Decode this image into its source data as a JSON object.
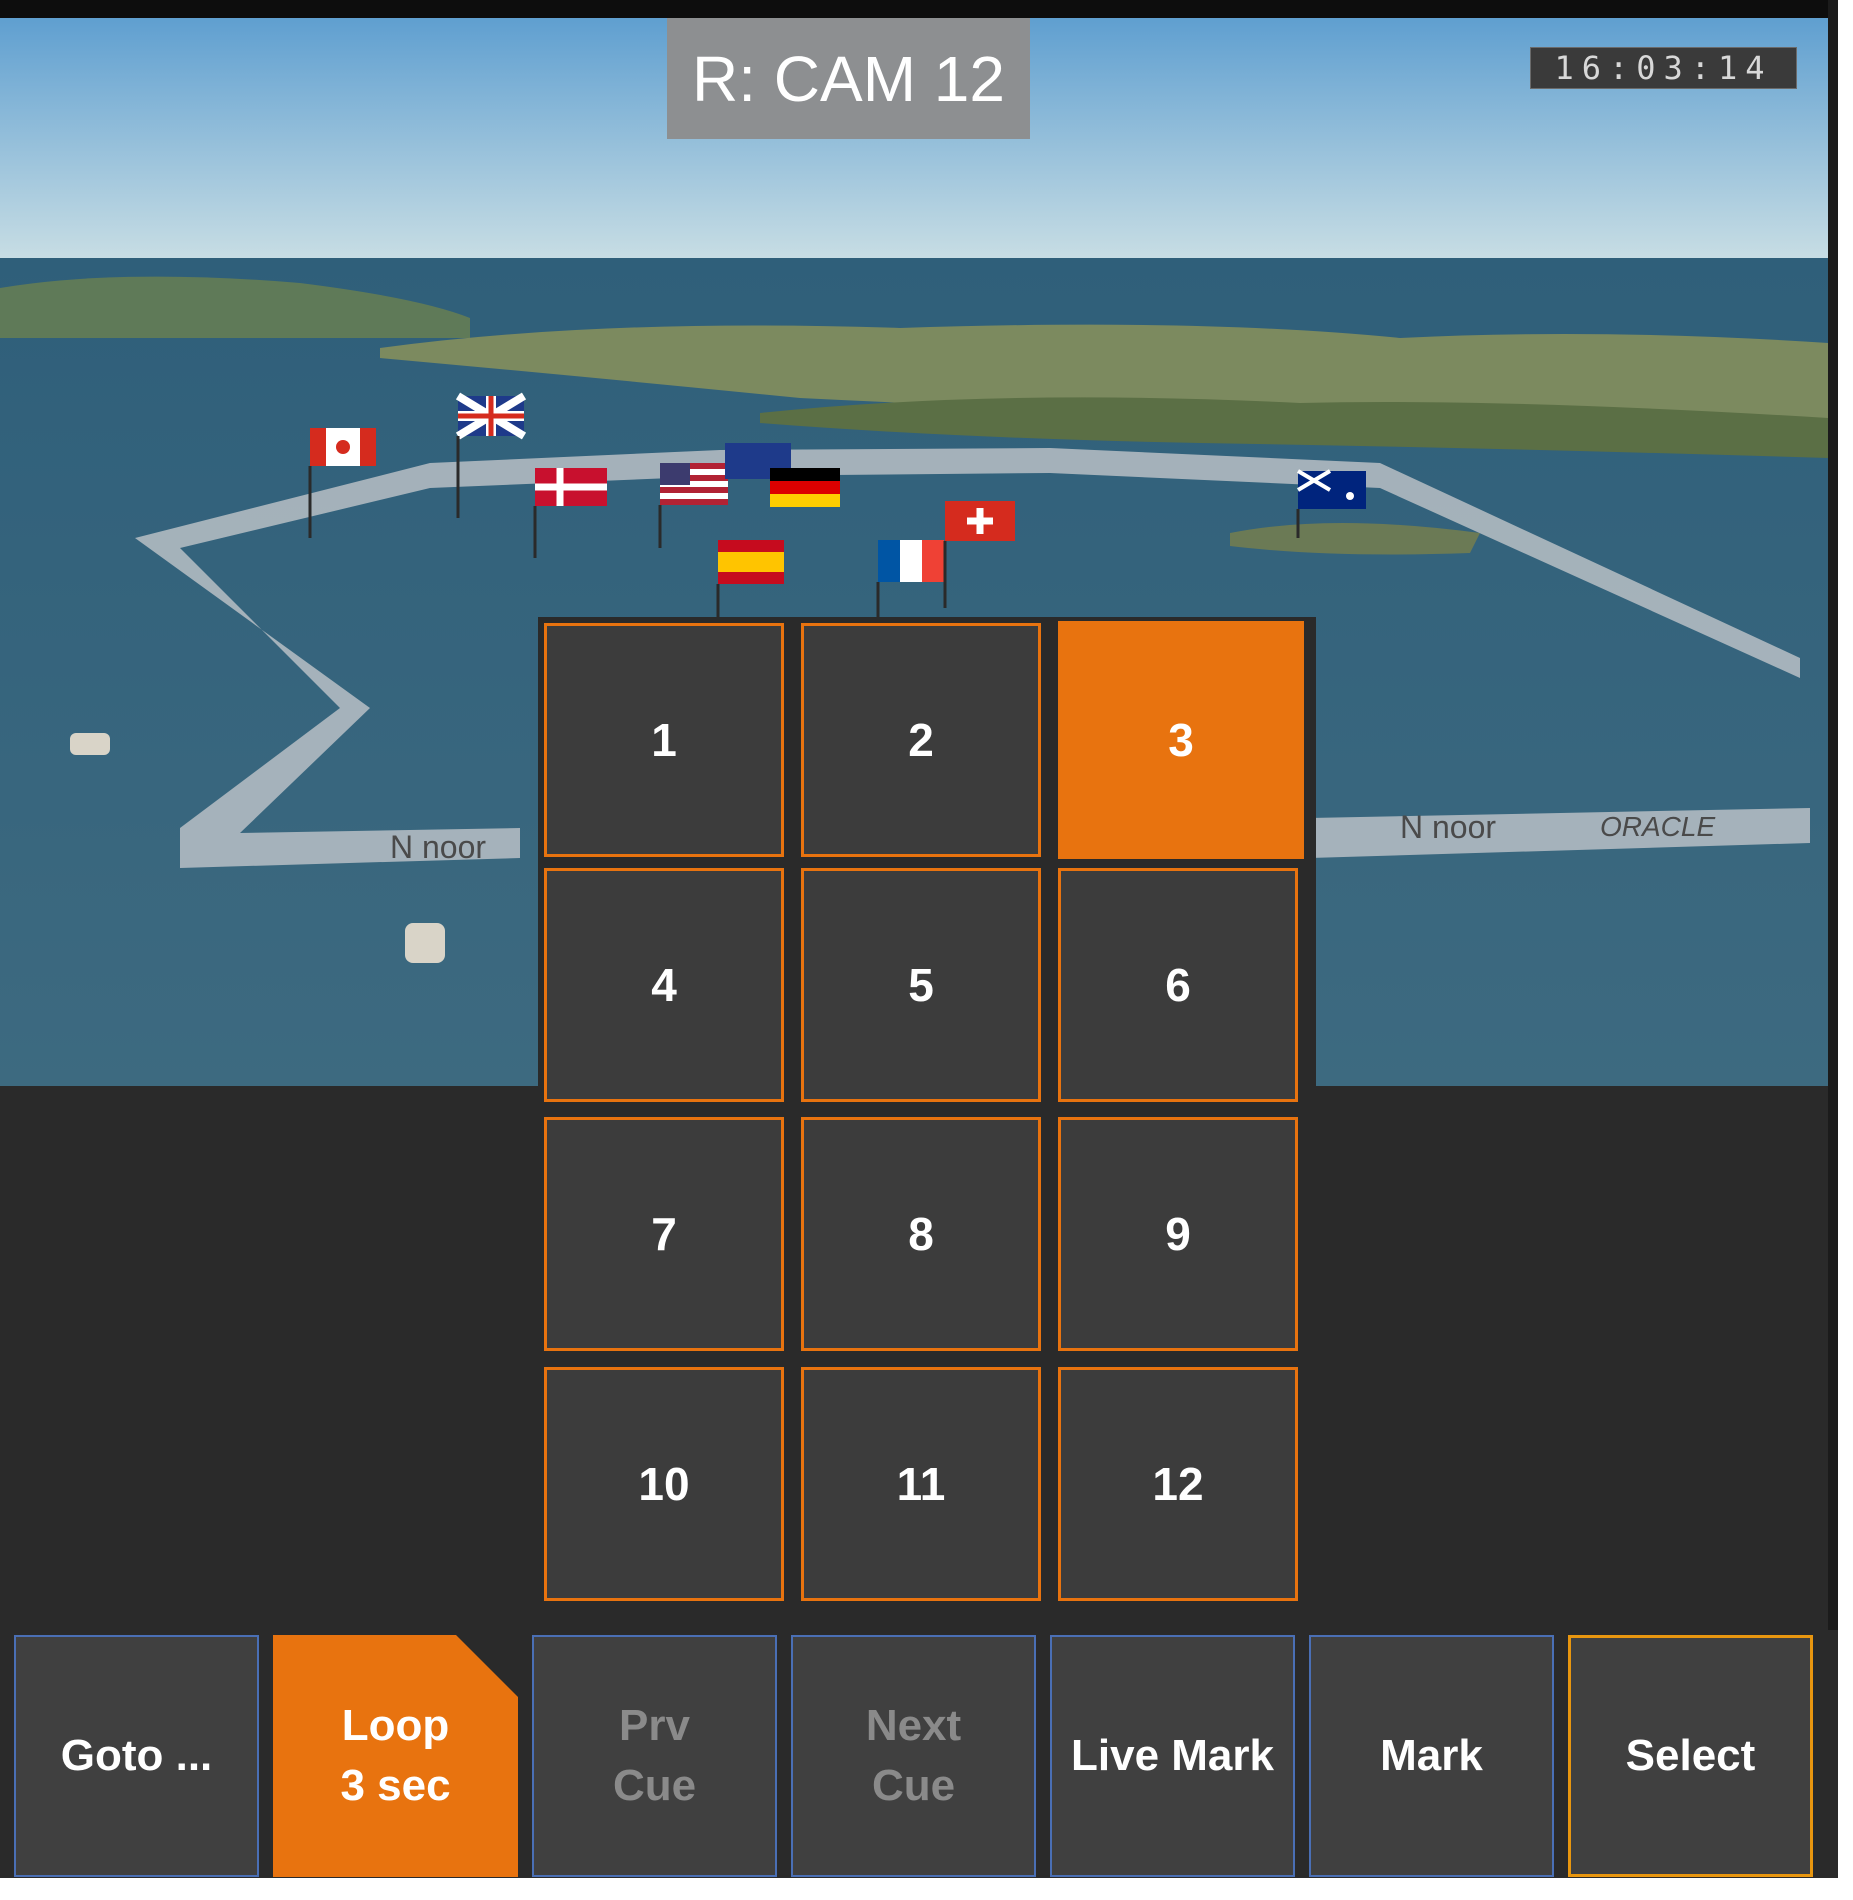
{
  "camera": {
    "label": "R: CAM 12",
    "timecode": "16:03:14"
  },
  "numpad": {
    "active": "3",
    "buttons": [
      "1",
      "2",
      "3",
      "4",
      "5",
      "6",
      "7",
      "8",
      "9",
      "10",
      "11",
      "12"
    ]
  },
  "toolbar": {
    "goto": "Goto ...",
    "loop": "Loop\n3 sec",
    "prev_cue": "Prv\nCue",
    "next_cue": "Next\nCue",
    "live_mark": "Live Mark",
    "mark": "Mark",
    "select": "Select"
  },
  "colors": {
    "accent": "#e8730f",
    "button_bg": "#3c3c3c",
    "panel_bg": "#2a2a2a",
    "blue_border": "#4a6fb5"
  }
}
